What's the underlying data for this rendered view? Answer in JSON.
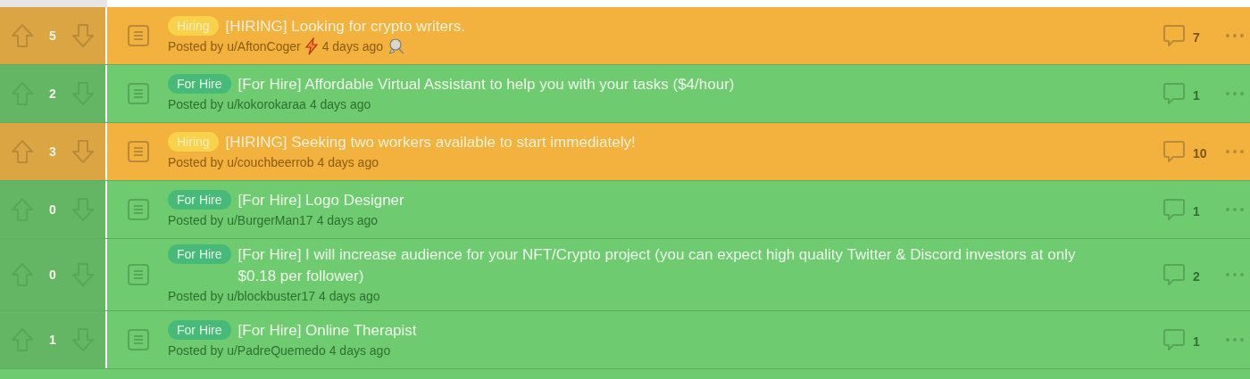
{
  "posts": [
    {
      "kind": "hiring",
      "score": "5",
      "flair": "Hiring",
      "title": "[HIRING] Looking for crypto writers.",
      "posted_by": "Posted by u/AftonCoger",
      "author_badge": true,
      "time": "4 days ago",
      "award": true,
      "comments": "7"
    },
    {
      "kind": "for_hire",
      "score": "2",
      "flair": "For Hire",
      "title": "[For Hire] Affordable Virtual Assistant to help you with your tasks ($4/hour)",
      "posted_by": "Posted by u/kokorokaraa",
      "author_badge": false,
      "time": "4 days ago",
      "award": false,
      "comments": "1"
    },
    {
      "kind": "hiring",
      "score": "3",
      "flair": "Hiring",
      "title": "[HIRING] Seeking two workers available to start immediately!",
      "posted_by": "Posted by u/couchbeerrob",
      "author_badge": false,
      "time": "4 days ago",
      "award": false,
      "comments": "10"
    },
    {
      "kind": "for_hire",
      "score": "0",
      "flair": "For Hire",
      "title": "[For Hire] Logo Designer",
      "posted_by": "Posted by u/BurgerMan17",
      "author_badge": false,
      "time": "4 days ago",
      "award": false,
      "comments": "1"
    },
    {
      "kind": "for_hire",
      "score": "0",
      "flair": "For Hire",
      "title": "[For Hire] I will increase audience for your NFT/Crypto project (you can expect high quality Twitter & Discord investors at only $0.18 per follower)",
      "posted_by": "Posted by u/blockbuster17",
      "author_badge": false,
      "time": "4 days ago",
      "award": false,
      "comments": "2"
    },
    {
      "kind": "for_hire",
      "score": "1",
      "flair": "For Hire",
      "title": "[For Hire] Online Therapist",
      "posted_by": "Posted by u/PadreQuemedo",
      "author_badge": false,
      "time": "4 days ago",
      "award": false,
      "comments": "1"
    }
  ]
}
